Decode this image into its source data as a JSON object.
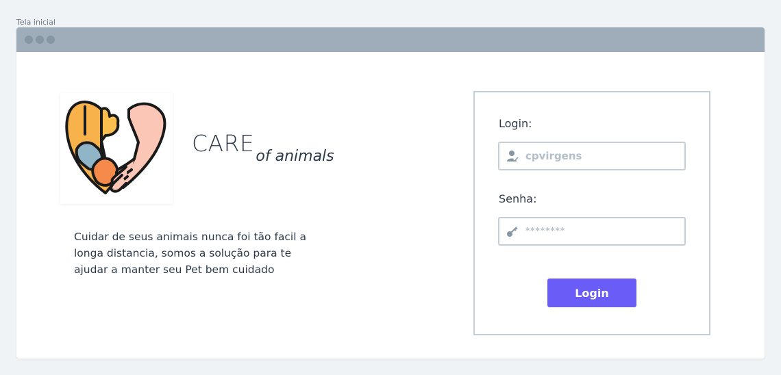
{
  "frame": {
    "label": "Tela inicial"
  },
  "brand": {
    "name": "CARE",
    "tagline_suffix": "of animals"
  },
  "tagline": "Cuidar de seus animais nunca foi tão facil a longa distancia, somos a solução para te ajudar a manter seu Pet bem cuidado",
  "login_form": {
    "login_label": "Login:",
    "login_value": "cpvirgens",
    "password_label": "Senha:",
    "password_value": "********",
    "submit_label": "Login"
  },
  "colors": {
    "accent": "#6a5cf6",
    "titlebar": "#9fadba",
    "text": "#2d3a4a",
    "input_border": "#c4ced7",
    "placeholder": "#b3c0cc"
  },
  "icons": {
    "logo": "heart-pet-hand-icon",
    "user": "user-icon",
    "key": "key-icon"
  }
}
